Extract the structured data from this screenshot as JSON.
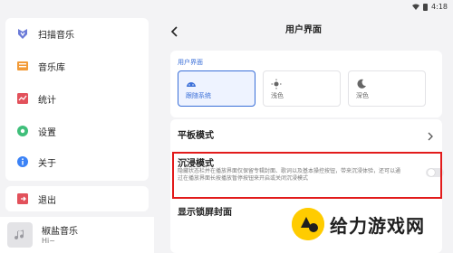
{
  "status": {
    "time": "4:18"
  },
  "sidebar": {
    "items": [
      {
        "label": "扫描音乐",
        "icon": "scan-music-icon",
        "color": "#6b7bd8"
      },
      {
        "label": "音乐库",
        "icon": "music-library-icon",
        "color": "#f29b38"
      },
      {
        "label": "统计",
        "icon": "statistics-icon",
        "color": "#e2515b"
      },
      {
        "label": "设置",
        "icon": "settings-icon",
        "color": "#3fbf7a"
      },
      {
        "label": "关于",
        "icon": "about-icon",
        "color": "#3b82f6"
      }
    ],
    "exit_label": "退出",
    "exit_icon_color": "#e2515b"
  },
  "mini_player": {
    "title": "椒盐音乐",
    "subtitle": "Hi~"
  },
  "header": {
    "title": "用户界面"
  },
  "ui_section": {
    "label": "用户界面",
    "themes": [
      {
        "label": "跟随系统",
        "icon": "android-icon",
        "selected": true
      },
      {
        "label": "浅色",
        "icon": "sun-icon",
        "selected": false
      },
      {
        "label": "深色",
        "icon": "moon-icon",
        "selected": false
      }
    ]
  },
  "tablet_mode": {
    "label": "平板模式"
  },
  "immersive_mode": {
    "label": "沉浸模式",
    "description": "隐藏状态栏并在播放界面仅保留专辑封面、歌词以及基本操控按钮，带来沉浸体验，还可以通过在播放界面长按播放暂停按钮来开启或关闭沉浸模式",
    "enabled": false
  },
  "next_setting": {
    "label": "显示锁屏封面"
  },
  "watermark": {
    "text": "给力游戏网"
  },
  "colors": {
    "accent": "#3a6fd8",
    "highlight_border": "#e21b1b",
    "watermark_yellow": "#ffcc00"
  }
}
